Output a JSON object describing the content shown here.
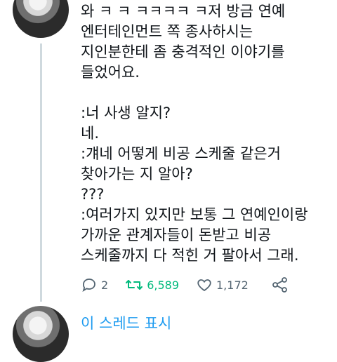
{
  "tweet": {
    "text": "와 ㅋ ㅋ ㅋㅋㅋㅋ ㅋ저 방금 연예\n엔터테인먼트 쪽 종사하시는\n지인분한테 좀 충격적인 이야기를\n들었어요.\n\n:너 사생 알지?\n네.\n:걔네 어떻게 비공 스케줄 같은거\n찾아가는 지 알아?\n???\n:여러가지 있지만 보통 그 연예인이랑\n가까운 관계자들이 돈받고 비공\n스케줄까지 다 적힌 거 팔아서 그래.",
    "reply_count": "2",
    "retweet_count": "6,589",
    "like_count": "1,172"
  },
  "thread": {
    "show_label": "이 스레드 표시"
  },
  "colors": {
    "accent": "#1d9bf0",
    "retweet": "#00ba7c",
    "muted": "#536471"
  },
  "icons": [
    "reply-icon",
    "retweet-icon",
    "like-icon",
    "share-icon"
  ]
}
